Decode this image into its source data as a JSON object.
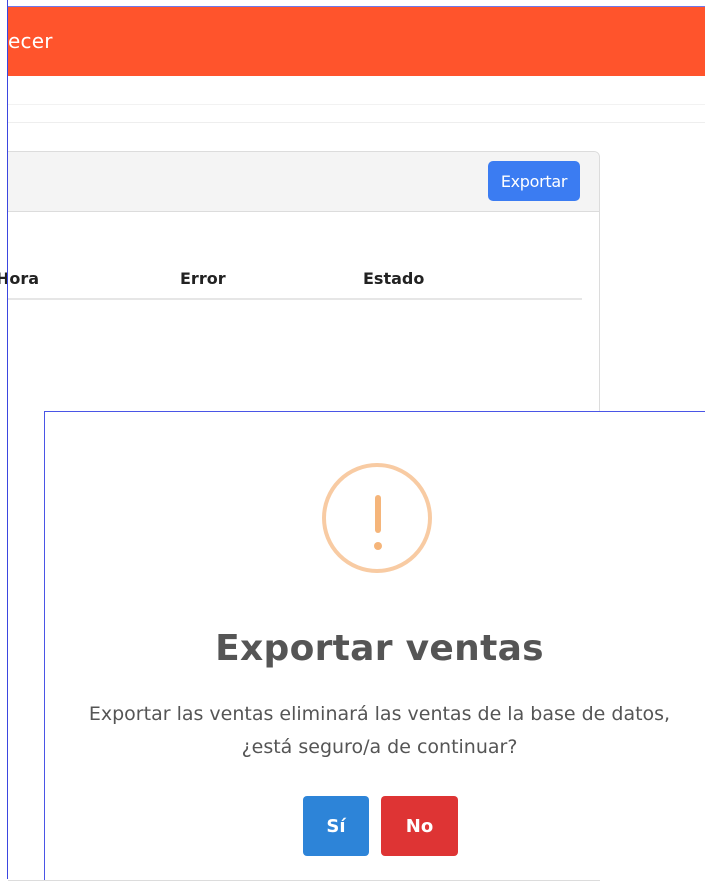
{
  "header": {
    "title_fragment": "ecer",
    "background": "#ff542c"
  },
  "card": {
    "export_label": "Exportar",
    "columns": [
      "Hora",
      "Error",
      "Estado"
    ]
  },
  "modal": {
    "icon": "warning-exclamation-icon",
    "title": "Exportar ventas",
    "message": "Exportar las ventas eliminará las ventas de la base de datos, ¿está seguro/a de continuar?",
    "confirm_label": "Sí",
    "cancel_label": "No"
  },
  "colors": {
    "accent_blue": "#3b7cf2",
    "confirm": "#2d84d8",
    "cancel": "#de3434",
    "warning": "#f8cba3"
  }
}
